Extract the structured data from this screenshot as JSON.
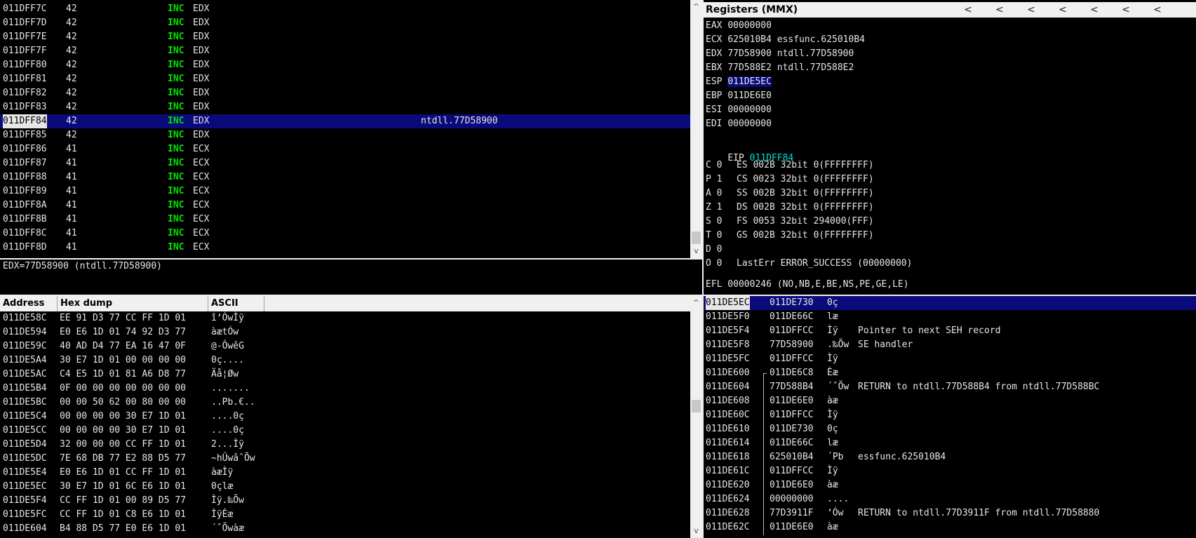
{
  "disasm": {
    "rows": [
      {
        "addr": "011DFF7C",
        "hex": "42",
        "mn": "INC",
        "op": "EDX",
        "cm": "",
        "sel": false
      },
      {
        "addr": "011DFF7D",
        "hex": "42",
        "mn": "INC",
        "op": "EDX",
        "cm": "",
        "sel": false
      },
      {
        "addr": "011DFF7E",
        "hex": "42",
        "mn": "INC",
        "op": "EDX",
        "cm": "",
        "sel": false
      },
      {
        "addr": "011DFF7F",
        "hex": "42",
        "mn": "INC",
        "op": "EDX",
        "cm": "",
        "sel": false
      },
      {
        "addr": "011DFF80",
        "hex": "42",
        "mn": "INC",
        "op": "EDX",
        "cm": "",
        "sel": false
      },
      {
        "addr": "011DFF81",
        "hex": "42",
        "mn": "INC",
        "op": "EDX",
        "cm": "",
        "sel": false
      },
      {
        "addr": "011DFF82",
        "hex": "42",
        "mn": "INC",
        "op": "EDX",
        "cm": "",
        "sel": false
      },
      {
        "addr": "011DFF83",
        "hex": "42",
        "mn": "INC",
        "op": "EDX",
        "cm": "",
        "sel": false
      },
      {
        "addr": "011DFF84",
        "hex": "42",
        "mn": "INC",
        "op": "EDX",
        "cm": "ntdll.77D58900",
        "sel": true
      },
      {
        "addr": "011DFF85",
        "hex": "42",
        "mn": "INC",
        "op": "EDX",
        "cm": "",
        "sel": false
      },
      {
        "addr": "011DFF86",
        "hex": "41",
        "mn": "INC",
        "op": "ECX",
        "cm": "",
        "sel": false
      },
      {
        "addr": "011DFF87",
        "hex": "41",
        "mn": "INC",
        "op": "ECX",
        "cm": "",
        "sel": false
      },
      {
        "addr": "011DFF88",
        "hex": "41",
        "mn": "INC",
        "op": "ECX",
        "cm": "",
        "sel": false
      },
      {
        "addr": "011DFF89",
        "hex": "41",
        "mn": "INC",
        "op": "ECX",
        "cm": "",
        "sel": false
      },
      {
        "addr": "011DFF8A",
        "hex": "41",
        "mn": "INC",
        "op": "ECX",
        "cm": "",
        "sel": false
      },
      {
        "addr": "011DFF8B",
        "hex": "41",
        "mn": "INC",
        "op": "ECX",
        "cm": "",
        "sel": false
      },
      {
        "addr": "011DFF8C",
        "hex": "41",
        "mn": "INC",
        "op": "ECX",
        "cm": "",
        "sel": false
      },
      {
        "addr": "011DFF8D",
        "hex": "41",
        "mn": "INC",
        "op": "ECX",
        "cm": "",
        "sel": false
      }
    ]
  },
  "info": {
    "text": "EDX=77D58900 (ntdll.77D58900)"
  },
  "registers": {
    "title": "Registers (MMX)",
    "chevron": "<",
    "gp": [
      {
        "name": "EAX",
        "val": "00000000",
        "cm": "",
        "hl": false
      },
      {
        "name": "ECX",
        "val": "625010B4",
        "cm": "essfunc.625010B4",
        "hl": false
      },
      {
        "name": "EDX",
        "val": "77D58900",
        "cm": "ntdll.77D58900",
        "hl": false
      },
      {
        "name": "EBX",
        "val": "77D588E2",
        "cm": "ntdll.77D588E2",
        "hl": false
      },
      {
        "name": "ESP",
        "val": "011DE5EC",
        "cm": "",
        "hl": true
      },
      {
        "name": "EBP",
        "val": "011DE6E0",
        "cm": "",
        "hl": false
      },
      {
        "name": "ESI",
        "val": "00000000",
        "cm": "",
        "hl": false
      },
      {
        "name": "EDI",
        "val": "00000000",
        "cm": "",
        "hl": false
      }
    ],
    "eip": {
      "name": "EIP",
      "val": "011DFF84"
    },
    "flags": [
      {
        "flag": "C 0",
        "seg": "ES 002B 32bit 0(FFFFFFFF)"
      },
      {
        "flag": "P 1",
        "seg": "CS 0023 32bit 0(FFFFFFFF)"
      },
      {
        "flag": "A 0",
        "seg": "SS 002B 32bit 0(FFFFFFFF)"
      },
      {
        "flag": "Z 1",
        "seg": "DS 002B 32bit 0(FFFFFFFF)"
      },
      {
        "flag": "S 0",
        "seg": "FS 0053 32bit 294000(FFF)"
      },
      {
        "flag": "T 0",
        "seg": "GS 002B 32bit 0(FFFFFFFF)"
      },
      {
        "flag": "D 0",
        "seg": ""
      },
      {
        "flag": "O 0",
        "seg": "LastErr ERROR_SUCCESS (00000000)"
      }
    ],
    "efl": "EFL 00000246 (NO,NB,E,BE,NS,PE,GE,LE)"
  },
  "dump": {
    "headers": {
      "address": "Address",
      "hex": "Hex dump",
      "ascii": "ASCII"
    },
    "rows": [
      {
        "addr": "011DE58C",
        "hex": "EE 91 D3 77 CC FF 1D 01",
        "ascii": "î‘ÓwÌÿ"
      },
      {
        "addr": "011DE594",
        "hex": "E0 E6 1D 01 74 92 D3 77",
        "ascii": "àætÓw"
      },
      {
        "addr": "011DE59C",
        "hex": "40 AD D4 77 EA 16 47 0F",
        "ascii": "@-ÔwêG"
      },
      {
        "addr": "011DE5A4",
        "hex": "30 E7 1D 01 00 00 00 00",
        "ascii": "0ç...."
      },
      {
        "addr": "011DE5AC",
        "hex": "C4 E5 1D 01 81 A6 D8 77",
        "ascii": "Äå¦Øw"
      },
      {
        "addr": "011DE5B4",
        "hex": "0F 00 00 00 00 00 00 00",
        "ascii": "......."
      },
      {
        "addr": "011DE5BC",
        "hex": "00 00 50 62 00 80 00 00",
        "ascii": "..Pb.€.."
      },
      {
        "addr": "011DE5C4",
        "hex": "00 00 00 00 30 E7 1D 01",
        "ascii": "....0ç"
      },
      {
        "addr": "011DE5CC",
        "hex": "00 00 00 00 30 E7 1D 01",
        "ascii": "....0ç"
      },
      {
        "addr": "011DE5D4",
        "hex": "32 00 00 00 CC FF 1D 01",
        "ascii": "2...Ìÿ"
      },
      {
        "addr": "011DE5DC",
        "hex": "7E 68 DB 77 E2 88 D5 77",
        "ascii": "~hÛwâˆÕw"
      },
      {
        "addr": "011DE5E4",
        "hex": "E0 E6 1D 01 CC FF 1D 01",
        "ascii": "àæÌÿ"
      },
      {
        "addr": "011DE5EC",
        "hex": "30 E7 1D 01 6C E6 1D 01",
        "ascii": "0çlæ"
      },
      {
        "addr": "011DE5F4",
        "hex": "CC FF 1D 01 00 89 D5 77",
        "ascii": "Ìÿ.‰Õw"
      },
      {
        "addr": "011DE5FC",
        "hex": "CC FF 1D 01 C8 E6 1D 01",
        "ascii": "ÌÿÈæ"
      },
      {
        "addr": "011DE604",
        "hex": "B4 88 D5 77 E0 E6 1D 01",
        "ascii": "´ˆÕwàæ"
      }
    ]
  },
  "stack": {
    "rows": [
      {
        "addr": "011DE5EC",
        "val": "011DE730",
        "ascii": "0ç",
        "cm": "",
        "sel": true
      },
      {
        "addr": "011DE5F0",
        "val": "011DE66C",
        "ascii": "læ",
        "cm": "",
        "sel": false
      },
      {
        "addr": "011DE5F4",
        "val": "011DFFCC",
        "ascii": "Ìÿ",
        "cm": "Pointer to next SEH record",
        "sel": false
      },
      {
        "addr": "011DE5F8",
        "val": "77D58900",
        "ascii": ".‰Õw",
        "cm": "SE handler",
        "sel": false
      },
      {
        "addr": "011DE5FC",
        "val": "011DFFCC",
        "ascii": "Ìÿ",
        "cm": "",
        "sel": false
      },
      {
        "addr": "011DE600",
        "val": "011DE6C8",
        "ascii": "Èæ",
        "cm": "",
        "sel": false
      },
      {
        "addr": "011DE604",
        "val": "77D588B4",
        "ascii": "´ˆÕw",
        "cm": "RETURN to ntdll.77D588B4 from ntdll.77D588BC",
        "sel": false
      },
      {
        "addr": "011DE608",
        "val": "011DE6E0",
        "ascii": "àæ",
        "cm": "",
        "sel": false
      },
      {
        "addr": "011DE60C",
        "val": "011DFFCC",
        "ascii": "Ìÿ",
        "cm": "",
        "sel": false
      },
      {
        "addr": "011DE610",
        "val": "011DE730",
        "ascii": "0ç",
        "cm": "",
        "sel": false
      },
      {
        "addr": "011DE614",
        "val": "011DE66C",
        "ascii": "læ",
        "cm": "",
        "sel": false
      },
      {
        "addr": "011DE618",
        "val": "625010B4",
        "ascii": "´Pb",
        "cm": "essfunc.625010B4",
        "sel": false
      },
      {
        "addr": "011DE61C",
        "val": "011DFFCC",
        "ascii": "Ìÿ",
        "cm": "",
        "sel": false
      },
      {
        "addr": "011DE620",
        "val": "011DE6E0",
        "ascii": "àæ",
        "cm": "",
        "sel": false
      },
      {
        "addr": "011DE624",
        "val": "00000000",
        "ascii": "....",
        "cm": "",
        "sel": false
      },
      {
        "addr": "011DE628",
        "val": "77D3911F",
        "ascii": "‘Ów",
        "cm": "RETURN to ntdll.77D3911F from ntdll.77D58880",
        "sel": false
      },
      {
        "addr": "011DE62C",
        "val": "011DE6E0",
        "ascii": "àæ",
        "cm": "",
        "sel": false
      }
    ]
  },
  "scroll": {
    "up": "^",
    "down": "v"
  }
}
